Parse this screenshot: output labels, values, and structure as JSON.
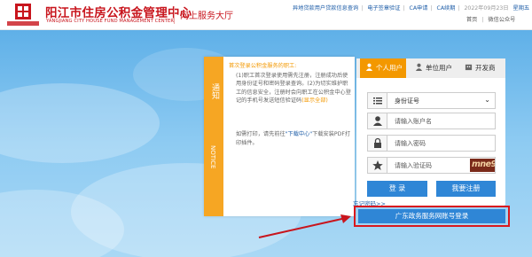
{
  "header": {
    "title_cn": "阳江市住房公积金管理中心",
    "title_en": "YANGJIANG CITY HOUSE FUND MANAGEMENT CENTER",
    "subtitle": "网上服务大厅",
    "links": [
      "异地贷款用户贷款信息查询",
      "电子签章验证",
      "CA申请",
      "CA续期"
    ],
    "date": "2022年09月23日",
    "weekday": "星期五",
    "home": "首页",
    "wechat": "微信公众号"
  },
  "notice": {
    "tab_cn": "通知",
    "tab_en": "NOTICE",
    "heading": "首次登录公积金服务的职工:",
    "para1": "(1)职工首次登录使用需先注册，注册成功后使用身份证号和密码登录查询。(2)为切实维护职工的信息安全，注册时会向职工在公积金中心登记的手机号发送短信验证码",
    "para1_link": "(显示全部)",
    "para2_prefix": "如需打印，请先前往",
    "para2_link": "\"下载中心\"",
    "para2_suffix": "下载安装PDF打印插件。"
  },
  "login": {
    "tabs": [
      "个人用户",
      "单位用户",
      "开发商"
    ],
    "id_type": "身份证号",
    "account_placeholder": "请输入账户名",
    "password_placeholder": "请输入密码",
    "captcha_placeholder": "请输入验证码",
    "captcha_text": "mne9e",
    "login_button": "登 录",
    "register_button": "我要注册",
    "forgot": "忘记密码>>",
    "gd_button": "广东政务服务网账号登录"
  },
  "colors": {
    "brand_red": "#c8151d",
    "orange": "#f39800",
    "blue": "#2f86d6",
    "highlight_red": "#d9181e"
  }
}
